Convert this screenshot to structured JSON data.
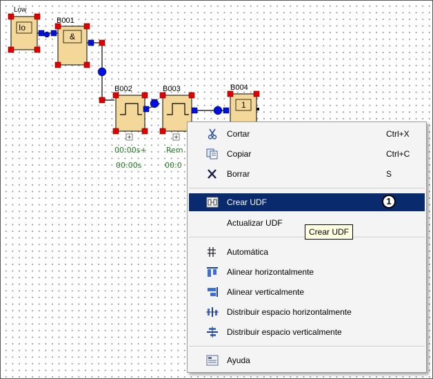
{
  "diagram": {
    "low_label": "Low",
    "io_label": "Io",
    "and_symbol": "&",
    "one_symbol": "1",
    "blocks": {
      "b001": "B001",
      "b002": "B002",
      "b003": "B003",
      "b004": "B004"
    },
    "timer_labels": {
      "b002_line1": "00:00s+",
      "b002_line2": "00:00s",
      "b003_line1": "Rem",
      "b003_line2": "00:0"
    }
  },
  "context_menu": {
    "items": [
      {
        "label": "Cortar",
        "shortcut": "Ctrl+X",
        "icon": "scissors-icon"
      },
      {
        "label": "Copiar",
        "shortcut": "Ctrl+C",
        "icon": "copy-icon"
      },
      {
        "label": "Borrar",
        "shortcut": "S",
        "icon": "delete-x-icon"
      },
      {
        "label": "Crear UDF",
        "shortcut": "",
        "icon": "udf-icon",
        "highlighted": true
      },
      {
        "label": "Actualizar  UDF",
        "shortcut": "",
        "icon": ""
      },
      {
        "label": "Automática",
        "shortcut": "",
        "icon": "auto-layout-icon"
      },
      {
        "label": "Alinear horizontalmente",
        "shortcut": "",
        "icon": "align-horizontal-icon"
      },
      {
        "label": "Alinear verticalmente",
        "shortcut": "",
        "icon": "align-vertical-icon"
      },
      {
        "label": "Distribuir espacio horizontalmente",
        "shortcut": "",
        "icon": "distribute-horizontal-icon"
      },
      {
        "label": "Distribuir espacio verticalmente",
        "shortcut": "",
        "icon": "distribute-vertical-icon"
      },
      {
        "label": "Ayuda",
        "shortcut": "",
        "icon": "help-icon"
      }
    ],
    "badge": "1",
    "tooltip": "Crear UDF"
  },
  "colors": {
    "highlight": "#0a2a6e",
    "block_fill": "#f4d89a",
    "pin_red": "#e00000",
    "pin_blue": "#0010e0",
    "label_green": "#1f7a1f"
  }
}
